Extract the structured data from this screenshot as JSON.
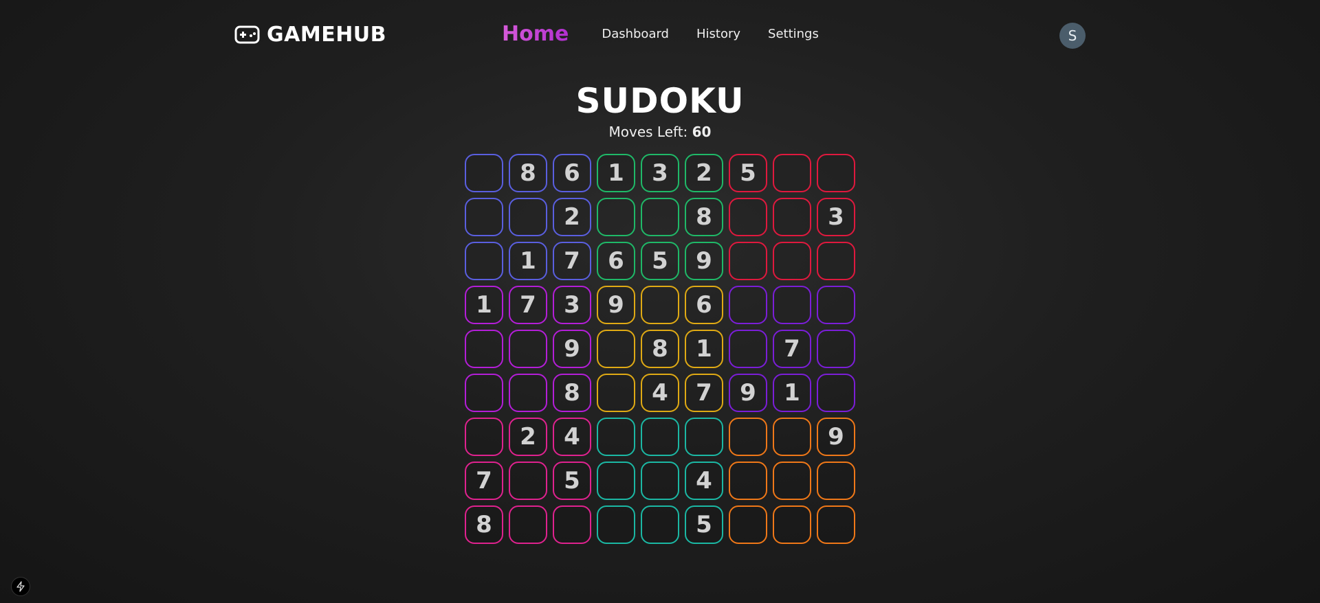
{
  "header": {
    "brand": "GAMEHUB",
    "brand_icon": "gamepad-icon",
    "nav": [
      {
        "label": "Home",
        "active": true
      },
      {
        "label": "Dashboard",
        "active": false
      },
      {
        "label": "History",
        "active": false
      },
      {
        "label": "Settings",
        "active": false
      }
    ],
    "avatar_initial": "S"
  },
  "game": {
    "title": "SUDOKU",
    "moves_label": "Moves Left: ",
    "moves_value": "60"
  },
  "board": {
    "grid": [
      [
        "",
        "8",
        "6",
        "1",
        "3",
        "2",
        "5",
        "",
        ""
      ],
      [
        "",
        "",
        "2",
        "",
        "",
        "8",
        "",
        "",
        "3"
      ],
      [
        "",
        "1",
        "7",
        "6",
        "5",
        "9",
        "",
        "",
        ""
      ],
      [
        "1",
        "7",
        "3",
        "9",
        "",
        "6",
        "",
        "",
        ""
      ],
      [
        "",
        "",
        "9",
        "",
        "8",
        "1",
        "",
        "7",
        ""
      ],
      [
        "",
        "",
        "8",
        "",
        "4",
        "7",
        "9",
        "1",
        ""
      ],
      [
        "",
        "2",
        "4",
        "",
        "",
        "",
        "",
        "",
        "9"
      ],
      [
        "7",
        "",
        "5",
        "",
        "",
        "4",
        "",
        "",
        ""
      ],
      [
        "8",
        "",
        "",
        "",
        "",
        "5",
        "",
        "",
        ""
      ]
    ],
    "box_colors": [
      [
        "#5a5fe0",
        "#1fb968",
        "#e0193e"
      ],
      [
        "#b41ed8",
        "#e0aa14",
        "#7b1ed8"
      ],
      [
        "#e0228f",
        "#1bb8a4",
        "#f07818"
      ]
    ]
  },
  "footer": {
    "icon": "bolt-icon"
  }
}
